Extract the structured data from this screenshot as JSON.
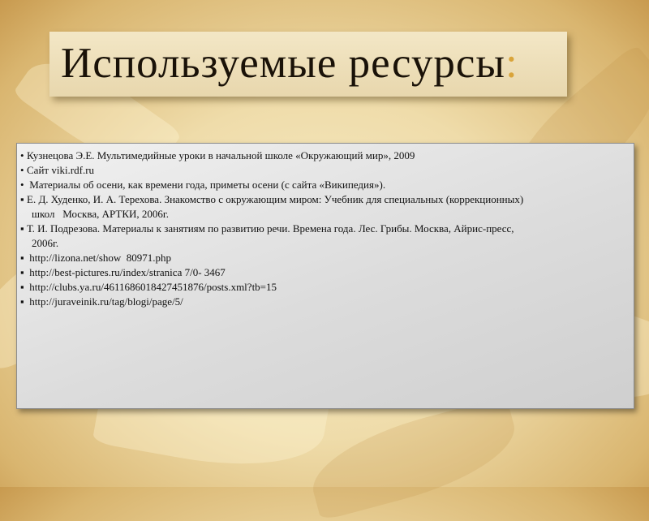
{
  "slide": {
    "title": "Используемые ресурсы",
    "title_punctuation": ":",
    "accent_color": "#d9a43a"
  },
  "resources": [
    {
      "bullet": "•",
      "lines": [
        "Кузнецова Э.Е. Мультимедийные уроки в начальной школе «Окружающий мир», 2009"
      ]
    },
    {
      "bullet": "•",
      "lines": [
        "Сайт viki.rdf.ru"
      ]
    },
    {
      "bullet": "•",
      "lines": [
        " Материалы об осени, как времени года, приметы осени (с сайта «Википедия»)."
      ]
    },
    {
      "bullet": "▪",
      "lines": [
        "Е. Д. Худенко, И. А. Терехова. Знакомство с окружающим миром: Учебник для специальных (коррекционных)",
        "школ   Москва, АРТКИ, 2006г."
      ]
    },
    {
      "bullet": "▪",
      "lines": [
        "Т. И. Подрезова. Материалы к занятиям по развитию речи. Времена года. Лес. Грибы. Москва, Айрис-пресс,",
        "2006г."
      ]
    },
    {
      "bullet": "▪",
      "lines": [
        " http://lizona.net/show  80971.php"
      ]
    },
    {
      "bullet": "▪",
      "lines": [
        " http://best-pictures.ru/index/stranica 7/0- 3467"
      ]
    },
    {
      "bullet": "▪",
      "lines": [
        " http://clubs.ya.ru/4611686018427451876/posts.xml?tb=15"
      ]
    },
    {
      "bullet": "▪",
      "lines": [
        " http://juraveinik.ru/tag/blogi/page/5/"
      ]
    }
  ]
}
